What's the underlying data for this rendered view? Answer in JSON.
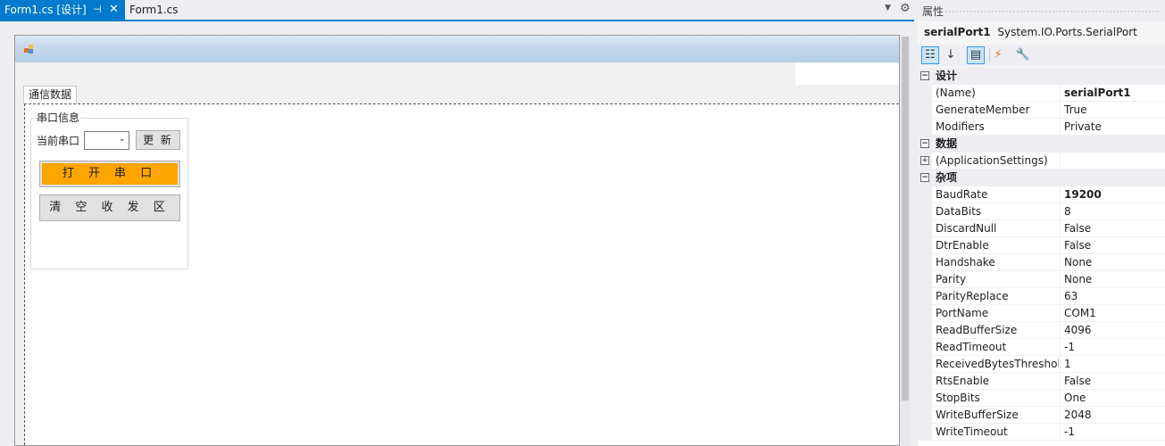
{
  "tabs": {
    "active_label": "Form1.cs [设计]",
    "inactive_label": "Form1.cs"
  },
  "designer": {
    "tab_page_label": "通信数据",
    "groupbox_title": "串口信息",
    "port_label": "当前串口",
    "port_combo_value": "",
    "refresh_button": "更 新",
    "open_button": "打 开 串 口",
    "open_button_color": "#ffa500",
    "clear_button": "清 空 收 发 区"
  },
  "properties": {
    "panel_title": "属性",
    "object_name": "serialPort1",
    "object_type": "System.IO.Ports.SerialPort",
    "toolbar_icons": [
      "categorized-icon",
      "alphabetical-icon",
      "properties-icon",
      "events-icon",
      "property-pages-icon"
    ],
    "categories": [
      {
        "name": "设计",
        "expanded": true,
        "items": [
          {
            "name": "(Name)",
            "value": "serialPort1",
            "bold": true
          },
          {
            "name": "GenerateMember",
            "value": "True",
            "bold": false
          },
          {
            "name": "Modifiers",
            "value": "Private",
            "bold": false
          }
        ]
      },
      {
        "name": "数据",
        "expanded": true,
        "items": [
          {
            "name": "(ApplicationSettings)",
            "value": "",
            "bold": false,
            "expandable": true
          }
        ]
      },
      {
        "name": "杂项",
        "expanded": true,
        "items": [
          {
            "name": "BaudRate",
            "value": "19200",
            "bold": true
          },
          {
            "name": "DataBits",
            "value": "8",
            "bold": false
          },
          {
            "name": "DiscardNull",
            "value": "False",
            "bold": false
          },
          {
            "name": "DtrEnable",
            "value": "False",
            "bold": false
          },
          {
            "name": "Handshake",
            "value": "None",
            "bold": false
          },
          {
            "name": "Parity",
            "value": "None",
            "bold": false
          },
          {
            "name": "ParityReplace",
            "value": "63",
            "bold": false
          },
          {
            "name": "PortName",
            "value": "COM1",
            "bold": false
          },
          {
            "name": "ReadBufferSize",
            "value": "4096",
            "bold": false
          },
          {
            "name": "ReadTimeout",
            "value": "-1",
            "bold": false
          },
          {
            "name": "ReceivedBytesThreshold",
            "value": "1",
            "bold": false
          },
          {
            "name": "RtsEnable",
            "value": "False",
            "bold": false
          },
          {
            "name": "StopBits",
            "value": "One",
            "bold": false
          },
          {
            "name": "WriteBufferSize",
            "value": "2048",
            "bold": false
          },
          {
            "name": "WriteTimeout",
            "value": "-1",
            "bold": false
          }
        ]
      }
    ]
  }
}
